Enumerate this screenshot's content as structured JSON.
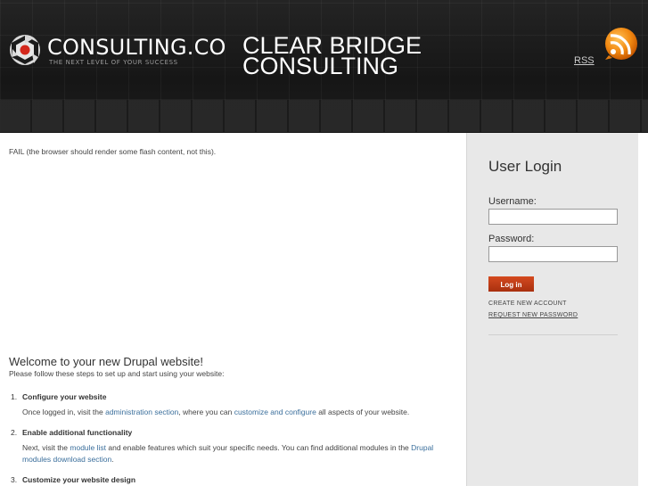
{
  "header": {
    "logo_name": "CONSULTING.CO",
    "logo_tagline": "THE NEXT LEVEL OF YOUR SUCCESS",
    "site_name_line1": "CLEAR BRIDGE",
    "site_name_line2": "CONSULTING",
    "rss_label": "RSS"
  },
  "main": {
    "flash_message": "FAIL (the browser should render some flash content, not this).",
    "welcome_title": "Welcome to your new Drupal website!",
    "welcome_intro": "Please follow these steps to set up and start using your website:",
    "steps": [
      {
        "num": "1.",
        "title": "Configure your website",
        "text_before": "Once logged in, visit the ",
        "link1": "administration section",
        "text_middle": ", where you can ",
        "link2": "customize and configure",
        "text_after": " all aspects of your website."
      },
      {
        "num": "2.",
        "title": "Enable additional functionality",
        "text_before": "Next, visit the ",
        "link1": "module list",
        "text_middle": " and enable features which suit your specific needs. You can find additional modules in the ",
        "link2": "Drupal modules download section",
        "text_after": "."
      },
      {
        "num": "3.",
        "title": "Customize your website design"
      }
    ]
  },
  "sidebar": {
    "login_title": "User Login",
    "username_label": "Username:",
    "username_value": "",
    "password_label": "Password:",
    "password_value": "",
    "login_button": "Log in",
    "create_account": "CREATE NEW ACCOUNT",
    "request_password": "REQUEST NEW PASSWORD"
  },
  "colors": {
    "accent": "#c23d15",
    "link": "#3b6f9c",
    "header_bg": "#1c1c1c",
    "sidebar_bg": "#e8e8e8"
  },
  "icons": [
    "consulting-logo-icon",
    "rss-feed-icon"
  ]
}
